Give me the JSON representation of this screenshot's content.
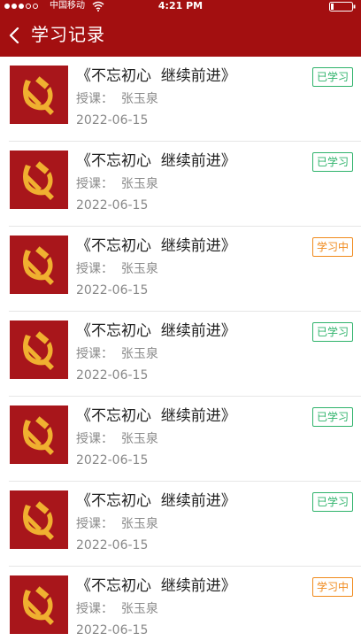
{
  "status_bar": {
    "carrier": "中国移动",
    "time": "4:21 PM"
  },
  "nav": {
    "title": "学习记录"
  },
  "colors": {
    "header_bg": "#a30f10",
    "done": "#2fb36b",
    "in_progress": "#f08a1c",
    "thumb_bg": "#a8161b",
    "emblem": "#f0b030"
  },
  "records": [
    {
      "title": "《不忘初心  继续前进》",
      "teacher": "授课：  张玉泉",
      "date": "2022-06-15",
      "status": "已学习",
      "state": "done",
      "icon": "party-emblem-icon"
    },
    {
      "title": "《不忘初心  继续前进》",
      "teacher": "授课：  张玉泉",
      "date": "2022-06-15",
      "status": "已学习",
      "state": "done",
      "icon": "party-emblem-icon"
    },
    {
      "title": "《不忘初心  继续前进》",
      "teacher": "授课：  张玉泉",
      "date": "2022-06-15",
      "status": "学习中",
      "state": "progress",
      "icon": "party-emblem-icon"
    },
    {
      "title": "《不忘初心  继续前进》",
      "teacher": "授课：  张玉泉",
      "date": "2022-06-15",
      "status": "已学习",
      "state": "done",
      "icon": "party-emblem-icon"
    },
    {
      "title": "《不忘初心  继续前进》",
      "teacher": "授课：  张玉泉",
      "date": "2022-06-15",
      "status": "已学习",
      "state": "done",
      "icon": "party-emblem-icon"
    },
    {
      "title": "《不忘初心  继续前进》",
      "teacher": "授课：  张玉泉",
      "date": "2022-06-15",
      "status": "已学习",
      "state": "done",
      "icon": "party-emblem-icon"
    },
    {
      "title": "《不忘初心  继续前进》",
      "teacher": "授课：  张玉泉",
      "date": "2022-06-15",
      "status": "学习中",
      "state": "progress",
      "icon": "party-emblem-icon"
    }
  ]
}
